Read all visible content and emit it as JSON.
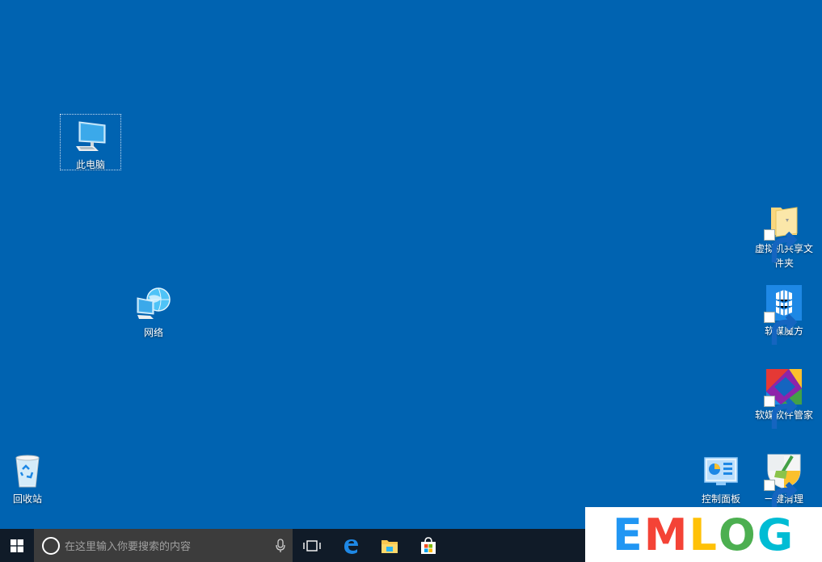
{
  "desktop": {
    "background": "#0063b1",
    "icons": {
      "this_pc": "此电脑",
      "network": "网络",
      "recycle_bin": "回收站",
      "shared_folder": "虚拟机共享文件夹",
      "rubik": "软媒魔方",
      "software_manager": "软媒软件管家",
      "control_panel": "控制面板",
      "one_click_clean": "一键清理"
    }
  },
  "taskbar": {
    "search_placeholder": "在这里输入你要搜索的内容",
    "icons": [
      "windows-start-icon",
      "cortana-icon",
      "microphone-icon",
      "task-view-icon",
      "edge-icon",
      "file-explorer-icon",
      "store-icon"
    ]
  },
  "watermark": {
    "letters": [
      "E",
      "M",
      "L",
      "O",
      "G"
    ],
    "colors": [
      "#2196f3",
      "#f44336",
      "#ffc107",
      "#4caf50",
      "#00bcd4"
    ]
  }
}
